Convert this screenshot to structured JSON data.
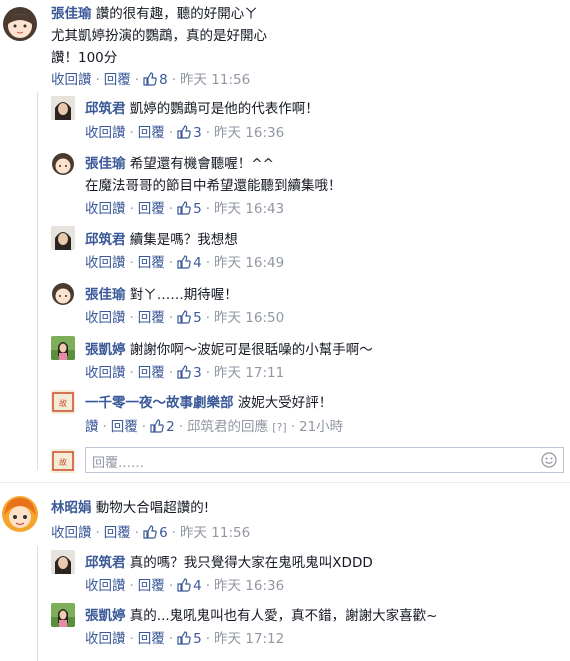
{
  "comments": [
    {
      "name": "張佳瑜",
      "lines": [
        "讚的很有趣，聽的好開心ㄚ",
        "尤其凱婷扮演的鸚鵡，真的是好開心",
        "讚！100分"
      ],
      "actions": [
        "收回讚",
        "回覆"
      ],
      "likes": "8",
      "time": "昨天 11:56"
    },
    {
      "name": "邱筑君",
      "lines": [
        "凱婷的鸚鵡可是他的代表作啊！"
      ],
      "actions": [
        "收回讚",
        "回覆"
      ],
      "likes": "3",
      "time": "昨天 16:36"
    },
    {
      "name": "張佳瑜",
      "lines": [
        "希望還有機會聽喔！^^",
        "在魔法哥哥的節目中希望還能聽到續集哦！"
      ],
      "actions": [
        "收回讚",
        "回覆"
      ],
      "likes": "5",
      "time": "昨天 16:43"
    },
    {
      "name": "邱筑君",
      "lines": [
        "續集是嗎？我想想"
      ],
      "actions": [
        "收回讚",
        "回覆"
      ],
      "likes": "4",
      "time": "昨天 16:49"
    },
    {
      "name": "張佳瑜",
      "lines": [
        "對ㄚ……期待喔！"
      ],
      "actions": [
        "收回讚",
        "回覆"
      ],
      "likes": "5",
      "time": "昨天 16:50"
    },
    {
      "name": "張凱婷",
      "lines": [
        "謝謝你啊～波妮可是很聒噪的小幫手啊～"
      ],
      "actions": [
        "收回讚",
        "回覆"
      ],
      "likes": "3",
      "time": "昨天 17:11"
    },
    {
      "name": "一千零一夜～故事劇樂部",
      "lines": [
        "波妮大受好評！"
      ],
      "actions": [
        "讚",
        "回覆"
      ],
      "likes": "2",
      "time": "21小時",
      "extra": "邱筑君的回應",
      "extra_q": "[?]"
    },
    {
      "name": "林昭娟",
      "lines": [
        "動物大合唱超讚的!"
      ],
      "actions": [
        "收回讚",
        "回覆"
      ],
      "likes": "6",
      "time": "昨天 11:56"
    },
    {
      "name": "邱筑君",
      "lines": [
        "真的嗎？我只覺得大家在鬼吼鬼叫XDDD"
      ],
      "actions": [
        "收回讚",
        "回覆"
      ],
      "likes": "4",
      "time": "昨天 16:36"
    },
    {
      "name": "張凱婷",
      "lines": [
        "真的...鬼吼鬼叫也有人愛，真不錯，謝謝大家喜歡~"
      ],
      "actions": [
        "收回讚",
        "回覆"
      ],
      "likes": "5",
      "time": "昨天 17:12"
    }
  ],
  "reply_box": {
    "placeholder": "回覆……"
  },
  "colors": {
    "link": "#3b5998",
    "meta": "#9197a3",
    "thread_line": "#dcdee3"
  }
}
